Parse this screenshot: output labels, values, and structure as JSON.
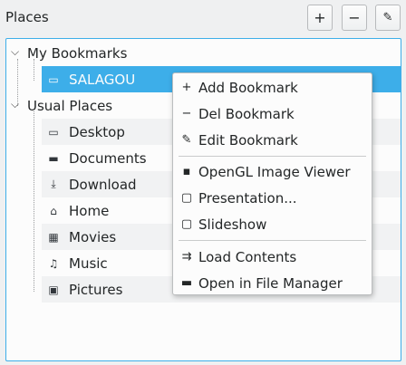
{
  "panel": {
    "title": "Places",
    "add_label": "+",
    "remove_label": "−",
    "edit_label": "✎"
  },
  "tree": {
    "groups": [
      {
        "label": "My Bookmarks",
        "expander": "⌵",
        "items": [
          {
            "label": "SALAGOU",
            "icon": "folder-icon",
            "glyph": "▭"
          }
        ]
      },
      {
        "label": "Usual Places",
        "expander": "⌵",
        "items": [
          {
            "label": "Desktop",
            "icon": "desktop-icon",
            "glyph": "▭"
          },
          {
            "label": "Documents",
            "icon": "folder-icon",
            "glyph": "▬"
          },
          {
            "label": "Download",
            "icon": "download-icon",
            "glyph": "⤓"
          },
          {
            "label": "Home",
            "icon": "home-icon",
            "glyph": "⌂"
          },
          {
            "label": "Movies",
            "icon": "film-icon",
            "glyph": "▦"
          },
          {
            "label": "Music",
            "icon": "music-icon",
            "glyph": "♫"
          },
          {
            "label": "Pictures",
            "icon": "image-icon",
            "glyph": "▣"
          }
        ]
      }
    ]
  },
  "context_menu": {
    "items": [
      {
        "label": "Add Bookmark",
        "icon": "plus-icon",
        "glyph": "+"
      },
      {
        "label": "Del Bookmark",
        "icon": "minus-icon",
        "glyph": "−"
      },
      {
        "label": "Edit Bookmark",
        "icon": "pencil-icon",
        "glyph": "✎"
      },
      {
        "label": "OpenGL Image Viewer",
        "icon": "chip-icon",
        "glyph": "▪"
      },
      {
        "label": "Presentation...",
        "icon": "presentation-icon",
        "glyph": "▢"
      },
      {
        "label": "Slideshow",
        "icon": "slideshow-icon",
        "glyph": "▢"
      },
      {
        "label": "Load Contents",
        "icon": "load-icon",
        "glyph": "⇉"
      },
      {
        "label": "Open in File Manager",
        "icon": "folder-open-icon",
        "glyph": "▬"
      }
    ]
  },
  "colors": {
    "accent": "#3daee9",
    "window_bg": "#eff0f1",
    "view_bg": "#fcfcfc"
  }
}
